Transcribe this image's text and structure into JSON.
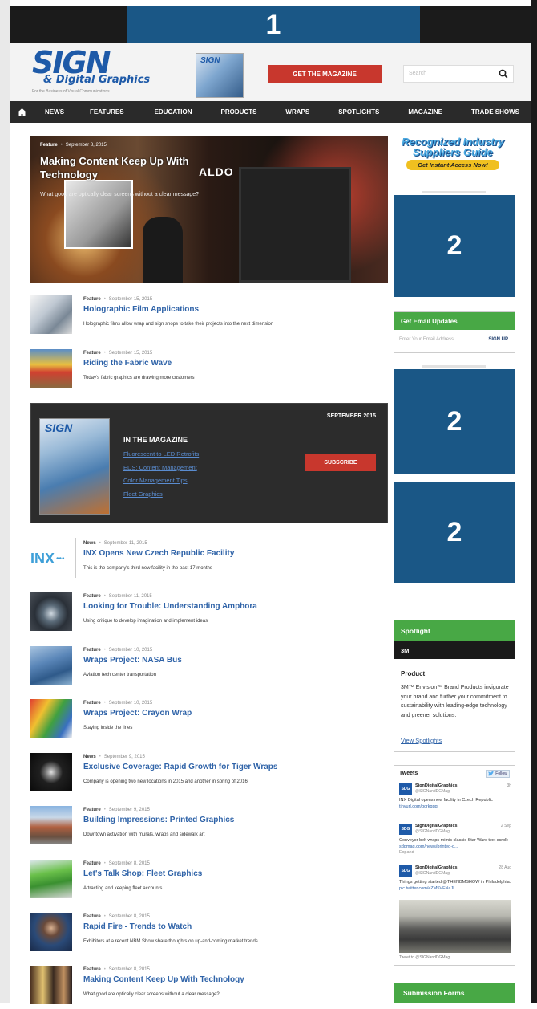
{
  "ads": {
    "top_label": "1",
    "side_label": "2"
  },
  "header": {
    "logo_sign": "SIGN",
    "logo_dg": "& Digital Graphics",
    "logo_tagline": "For the Business of Visual Communications",
    "mag_thumb": "SIGN",
    "get_magazine": "GET THE MAGAZINE",
    "search_placeholder": "Search"
  },
  "nav": [
    "NEWS",
    "FEATURES",
    "EDUCATION",
    "PRODUCTS",
    "WRAPS",
    "SPOTLIGHTS",
    "MAGAZINE",
    "TRADE SHOWS"
  ],
  "hero": {
    "category": "Feature",
    "date": "September 8, 2015",
    "title": "Making Content Keep Up With Technology",
    "desc": "What good are optically clear screens without a clear message?",
    "brand": "ALDO"
  },
  "articles_top": [
    {
      "category": "Feature",
      "date": "September 15, 2015",
      "title": "Holographic Film Applications",
      "desc": "Holographic films allow wrap and sign shops to take their projects into the next dimension"
    },
    {
      "category": "Feature",
      "date": "September 15, 2015",
      "title": "Riding the Fabric Wave",
      "desc": "Today's fabric graphics are drawing more customers"
    }
  ],
  "in_magazine": {
    "date": "SEPTEMBER 2015",
    "cover_title": "SIGN",
    "heading": "IN THE MAGAZINE",
    "links": [
      "Fluorescent to LED Retrofits",
      "EDS: Content Management",
      "Color Management Tips",
      "Fleet Graphics"
    ],
    "subscribe": "SUBSCRIBE"
  },
  "articles": [
    {
      "category": "News",
      "date": "September 11, 2015",
      "title": "INX Opens New Czech Republic Facility",
      "desc": "This is the company's third new facility in the past 17 months",
      "logo": "INX"
    },
    {
      "category": "Feature",
      "date": "September 11, 2015",
      "title": "Looking for Trouble: Understanding Amphora",
      "desc": "Using critique to develop imagination and implement ideas"
    },
    {
      "category": "Feature",
      "date": "September 10, 2015",
      "title": "Wraps Project: NASA Bus",
      "desc": "Aviation tech center transportation"
    },
    {
      "category": "Feature",
      "date": "September 10, 2015",
      "title": "Wraps Project: Crayon Wrap",
      "desc": "Staying inside the lines"
    },
    {
      "category": "News",
      "date": "September 9, 2015",
      "title": "Exclusive Coverage: Rapid Growth for Tiger Wraps",
      "desc": "Company is opening two new locations in 2015 and another in spring of 2016"
    },
    {
      "category": "Feature",
      "date": "September 9, 2015",
      "title": "Building Impressions: Printed Graphics",
      "desc": "Downtown activation with murals, wraps and sidewalk art"
    },
    {
      "category": "Feature",
      "date": "September 8, 2015",
      "title": "Let's Talk Shop: Fleet Graphics",
      "desc": "Attracting and keeping fleet accounts"
    },
    {
      "category": "Feature",
      "date": "September 8, 2015",
      "title": "Rapid Fire - Trends to Watch",
      "desc": "Exhibitors at a recent NBM Show share thoughts on up-and-coming market trends"
    },
    {
      "category": "Feature",
      "date": "September 8, 2015",
      "title": "Making Content Keep Up With Technology",
      "desc": "What good are optically clear screens without a clear message?"
    }
  ],
  "sidebar": {
    "suppliers_line1": "Recognized Industry",
    "suppliers_line2": "Suppliers Guide",
    "suppliers_cta": "Get Instant Access Now!",
    "email_heading": "Get Email Updates",
    "email_placeholder": "Enter Your Email Address",
    "email_button": "SIGN UP",
    "spotlight_heading": "Spotlight",
    "spotlight_sub": "3M",
    "spotlight_product_label": "Product",
    "spotlight_text": "3M™ Envision™ Brand Products invigorate your brand and further your commitment to sustainability with leading-edge technology and greener solutions.",
    "spotlight_link": "View Spotlights",
    "tweets_heading": "Tweets",
    "follow": "Follow",
    "tweets": [
      {
        "name": "SignDigitalGraphics",
        "handle": "@SIGNandDGMag",
        "date": "3h",
        "text": "INX Digital opens new facility in Czech Republic ",
        "link": "tinyurl.com/pcrkqqg"
      },
      {
        "name": "SignDigitalGraphics",
        "handle": "@SIGNandDGMag",
        "date": "2 Sep",
        "text": "Conveyor belt wraps mimic classic Star Wars text scroll: ",
        "link": "sdgmag.com/news/printed-c...",
        "extra": "Expand"
      },
      {
        "name": "SignDigitalGraphics",
        "handle": "@SIGNandDGMag",
        "date": "28 Aug",
        "text": "Things getting started @THENBMSHOW in Philadelphia. ",
        "link": "pic.twitter.com/eZM5VFNaJL"
      }
    ],
    "tweet_to": "Tweet to @SIGNandDGMag",
    "submission_forms": "Submission Forms"
  },
  "colors": {
    "accent_blue": "#2f63a8",
    "ad_blue": "#1a5786",
    "green": "#48a845",
    "red": "#c8372d"
  }
}
